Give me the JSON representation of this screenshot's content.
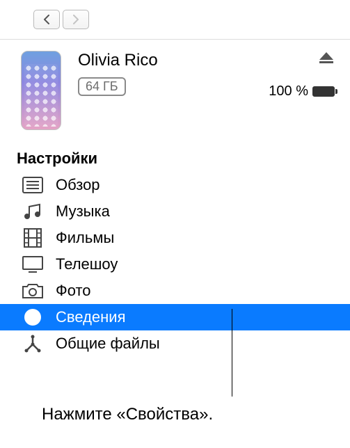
{
  "device": {
    "name": "Olivia Rico",
    "storage": "64 ГБ",
    "battery_percent": "100 %"
  },
  "section_title": "Настройки",
  "sidebar": {
    "items": [
      {
        "label": "Обзор",
        "icon": "list-icon",
        "selected": false
      },
      {
        "label": "Музыка",
        "icon": "music-icon",
        "selected": false
      },
      {
        "label": "Фильмы",
        "icon": "film-icon",
        "selected": false
      },
      {
        "label": "Телешоу",
        "icon": "tv-icon",
        "selected": false
      },
      {
        "label": "Фото",
        "icon": "camera-icon",
        "selected": false
      },
      {
        "label": "Сведения",
        "icon": "info-icon",
        "selected": true
      },
      {
        "label": "Общие файлы",
        "icon": "apps-icon",
        "selected": false
      }
    ]
  },
  "callout": "Нажмите «Свойства»."
}
